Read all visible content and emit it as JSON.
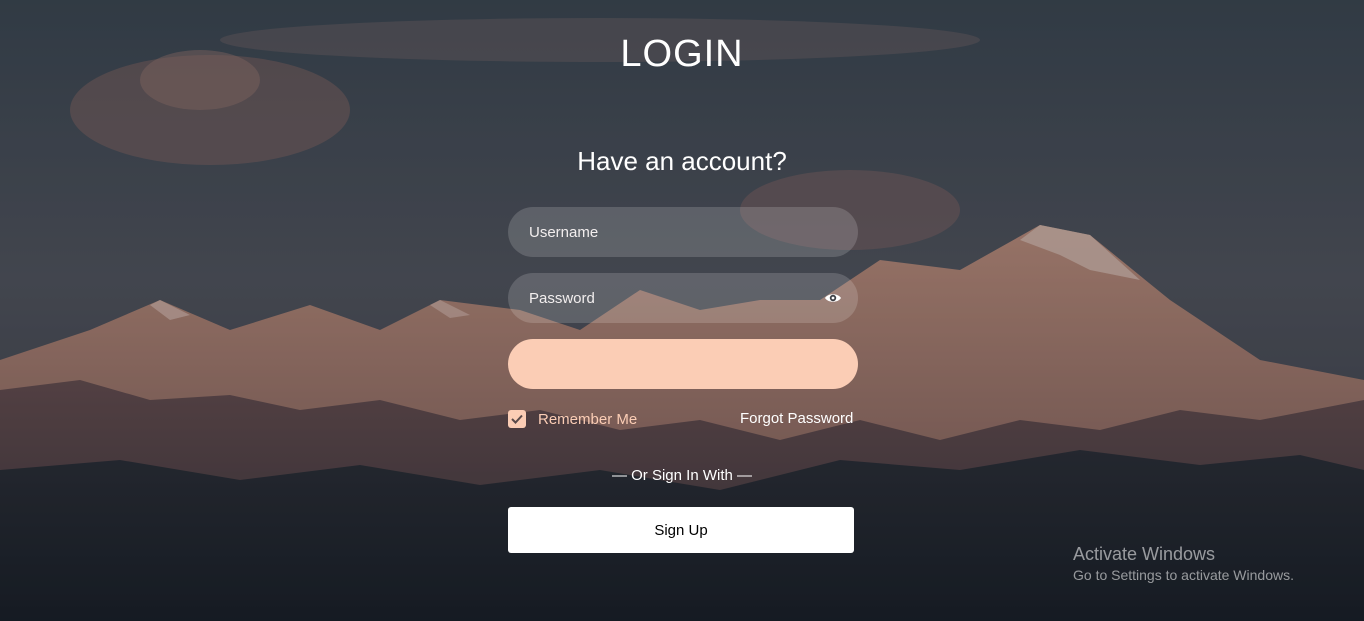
{
  "page": {
    "title": "LOGIN",
    "subtitle": "Have an account?"
  },
  "form": {
    "username_placeholder": "Username",
    "username_value": "",
    "password_placeholder": "Password",
    "password_value": "",
    "password_toggle_icon": "eye-icon",
    "submit_label": "",
    "remember_label": "Remember Me",
    "remember_checked": true,
    "forgot_label": "Forgot Password",
    "or_sign_in_with": "— Or Sign In With —",
    "signup_label": "Sign Up"
  },
  "colors": {
    "accent": "#fbcdb5",
    "field_bg": "rgba(255,255,255,0.16)",
    "text": "#ffffff"
  },
  "watermark": {
    "line1": "Activate Windows",
    "line2": "Go to Settings to activate Windows."
  }
}
